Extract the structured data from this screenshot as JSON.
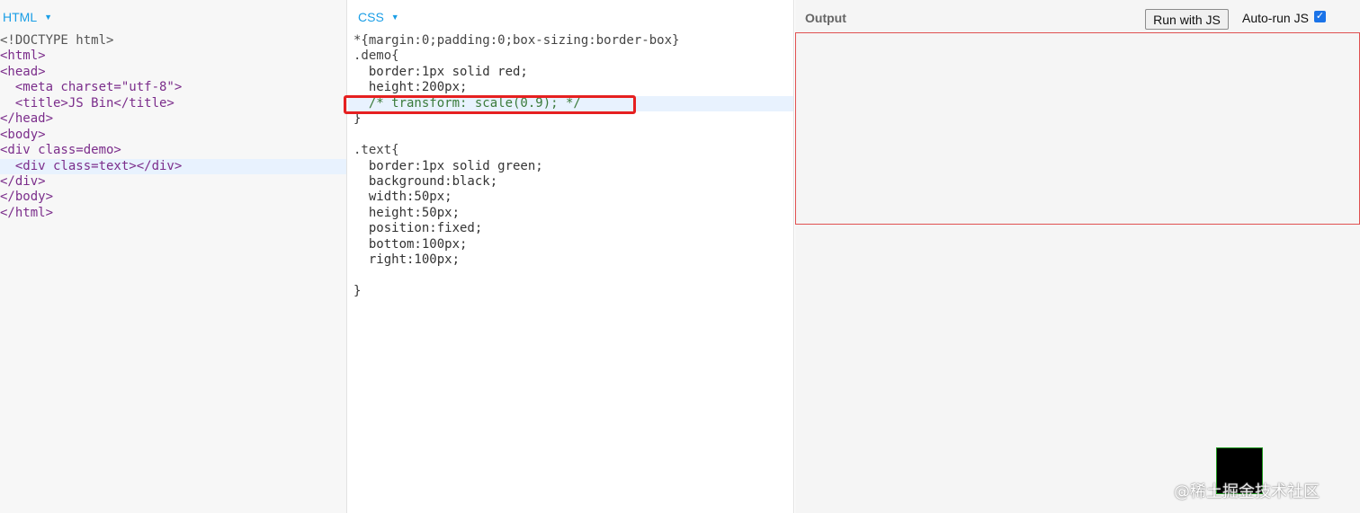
{
  "html_panel": {
    "label": "HTML",
    "lines": [
      "<!DOCTYPE html>",
      "<html>",
      "<head>",
      "  <meta charset=\"utf-8\">",
      "  <title>JS Bin</title>",
      "</head>",
      "<body>",
      "<div class=demo>",
      "  <div class=text></div>",
      "</div>",
      "</body>",
      "</html>"
    ]
  },
  "css_panel": {
    "label": "CSS",
    "lines": [
      "*{margin:0;padding:0;box-sizing:border-box}",
      ".demo{",
      "  border:1px solid red;",
      "  height:200px;",
      "  /* transform: scale(0.9); */",
      "}",
      "",
      ".text{",
      "  border:1px solid green;",
      "  background:black;",
      "  width:50px;",
      "  height:50px;",
      "  position:fixed;",
      "  bottom:100px;",
      "  right:100px;",
      "",
      "}"
    ]
  },
  "output_panel": {
    "label": "Output",
    "run_button": "Run with JS",
    "autorun_label": "Auto-run JS",
    "autorun_checked": true,
    "popout_icon": "arrow-up-right-icon"
  },
  "watermark": "@稀土掘金技术社区",
  "colors": {
    "accent": "#1a9ee6",
    "highlight_border": "#e62020",
    "demo_border": "#e05050",
    "text_box_border": "#1e9a1e"
  }
}
